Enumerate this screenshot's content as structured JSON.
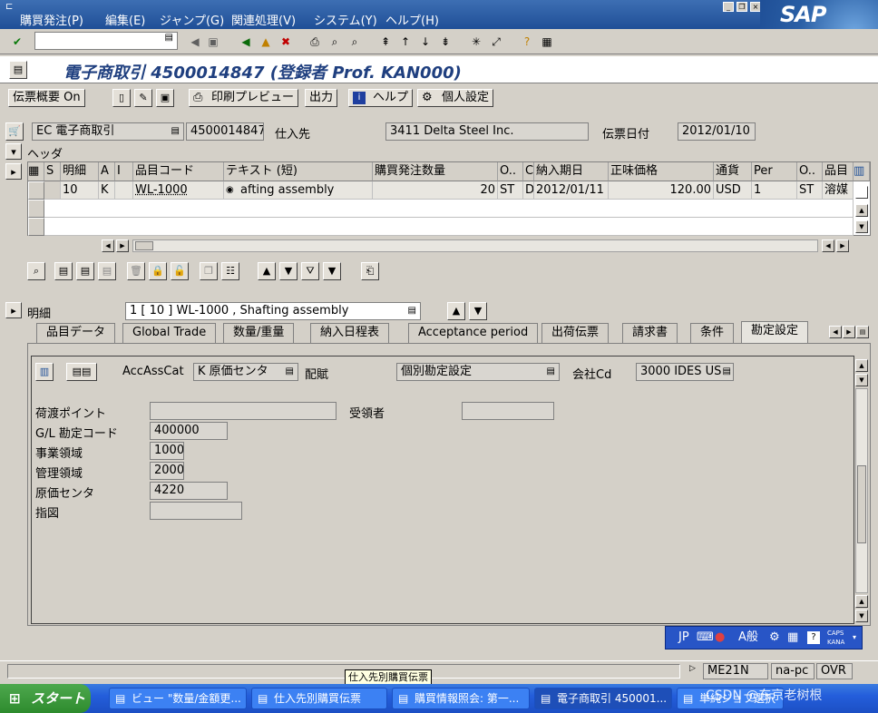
{
  "menu": {
    "items": [
      "購買発注(P)",
      "編集(E)",
      "ジャンプ(G)",
      "関連処理(V)",
      "システム(Y)",
      "ヘルプ(H)"
    ]
  },
  "logo": "SAP",
  "title": "電子商取引 4500014847 (登録者 Prof. KAN000)",
  "apptoolbar": {
    "doc_overview": "伝票概要 On",
    "print_preview": "印刷プレビュー",
    "output": "出力",
    "help": "ヘルプ",
    "personal": "個人設定"
  },
  "header": {
    "doc_type": "EC 電子商取引",
    "doc_number": "4500014847",
    "vendor_label": "仕入先",
    "vendor": "3411 Delta Steel Inc.",
    "doc_date_label": "伝票日付",
    "doc_date": "2012/01/10",
    "header_label": "ヘッダ"
  },
  "table": {
    "columns": [
      "S",
      "明細",
      "A",
      "I",
      "品目コード",
      "テキスト (短)",
      "購買発注数量",
      "O..",
      "C",
      "納入期日",
      "正味価格",
      "通貨",
      "Per",
      "O..",
      "品目"
    ],
    "rows": [
      [
        "",
        "10",
        "K",
        "",
        "WL-1000",
        "afting assembly",
        "20",
        "ST",
        "D",
        "2012/01/11",
        "120.00",
        "USD",
        "1",
        "ST",
        "溶媒"
      ]
    ]
  },
  "item": {
    "label": "明細",
    "selector": "1 [ 10 ] WL-1000 , Shafting assembly"
  },
  "tabs": [
    "品目データ",
    "Global Trade",
    "数量/重量",
    "納入日程表",
    "Acceptance period",
    "出荷伝票",
    "請求書",
    "条件",
    "勘定設定"
  ],
  "account": {
    "acc_cat_label": "AccAssCat",
    "acc_cat": "K 原価センタ",
    "distribution_label": "配賦",
    "distribution": "個別勘定設定",
    "company_label": "会社Cd",
    "company": "3000 IDES US",
    "unloading_label": "荷渡ポイント",
    "unloading": "",
    "recipient_label": "受領者",
    "recipient": "",
    "gl_label": "G/L 勘定コード",
    "gl": "400000",
    "ba_label": "事業領域",
    "ba": "1000",
    "ca_label": "管理領域",
    "ca": "2000",
    "cc_label": "原価センタ",
    "cc": "4220",
    "order_label": "指図",
    "order": ""
  },
  "status": {
    "tcode": "ME21N",
    "host": "na-pc",
    "mode": "OVR",
    "tooltip": "仕入先別購買伝票"
  },
  "ime": {
    "lang": "JP",
    "kana": "A般",
    "caps": "CAPS",
    "kana2": "KANA"
  },
  "taskbar": {
    "start": "スタート",
    "tasks": [
      "ビュー \"数量/金額更...",
      "仕入先別購買伝票",
      "購買情報照会: 第一...",
      "電子商取引 450001...",
      "単純ジョブ選択"
    ],
    "watermark": "CSDN @东京老树根"
  }
}
